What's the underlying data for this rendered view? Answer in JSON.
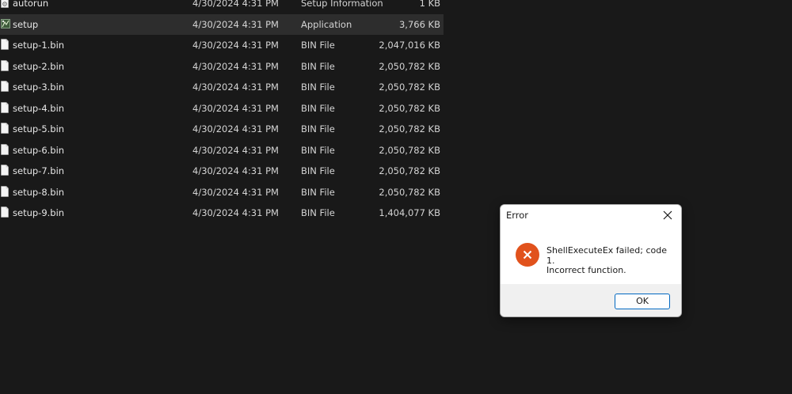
{
  "files": [
    {
      "name": "autorun",
      "date": "4/30/2024 4:31 PM",
      "type": "Setup Information",
      "size": "1 KB",
      "icon": "settings-file-icon",
      "selected": false
    },
    {
      "name": "setup",
      "date": "4/30/2024 4:31 PM",
      "type": "Application",
      "size": "3,766 KB",
      "icon": "application-icon",
      "selected": true
    },
    {
      "name": "setup-1.bin",
      "date": "4/30/2024 4:31 PM",
      "type": "BIN File",
      "size": "2,047,016 KB",
      "icon": "file-icon",
      "selected": false
    },
    {
      "name": "setup-2.bin",
      "date": "4/30/2024 4:31 PM",
      "type": "BIN File",
      "size": "2,050,782 KB",
      "icon": "file-icon",
      "selected": false
    },
    {
      "name": "setup-3.bin",
      "date": "4/30/2024 4:31 PM",
      "type": "BIN File",
      "size": "2,050,782 KB",
      "icon": "file-icon",
      "selected": false
    },
    {
      "name": "setup-4.bin",
      "date": "4/30/2024 4:31 PM",
      "type": "BIN File",
      "size": "2,050,782 KB",
      "icon": "file-icon",
      "selected": false
    },
    {
      "name": "setup-5.bin",
      "date": "4/30/2024 4:31 PM",
      "type": "BIN File",
      "size": "2,050,782 KB",
      "icon": "file-icon",
      "selected": false
    },
    {
      "name": "setup-6.bin",
      "date": "4/30/2024 4:31 PM",
      "type": "BIN File",
      "size": "2,050,782 KB",
      "icon": "file-icon",
      "selected": false
    },
    {
      "name": "setup-7.bin",
      "date": "4/30/2024 4:31 PM",
      "type": "BIN File",
      "size": "2,050,782 KB",
      "icon": "file-icon",
      "selected": false
    },
    {
      "name": "setup-8.bin",
      "date": "4/30/2024 4:31 PM",
      "type": "BIN File",
      "size": "2,050,782 KB",
      "icon": "file-icon",
      "selected": false
    },
    {
      "name": "setup-9.bin",
      "date": "4/30/2024 4:31 PM",
      "type": "BIN File",
      "size": "1,404,077 KB",
      "icon": "file-icon",
      "selected": false
    }
  ],
  "dialog": {
    "title": "Error",
    "message_line1": "ShellExecuteEx failed; code 1.",
    "message_line2": "Incorrect function.",
    "ok_label": "OK",
    "icon": "error-icon",
    "error_color": "#e1521c"
  },
  "colors": {
    "background": "#191919",
    "selected_row": "#2d2d2d",
    "button_border": "#0067c0"
  }
}
